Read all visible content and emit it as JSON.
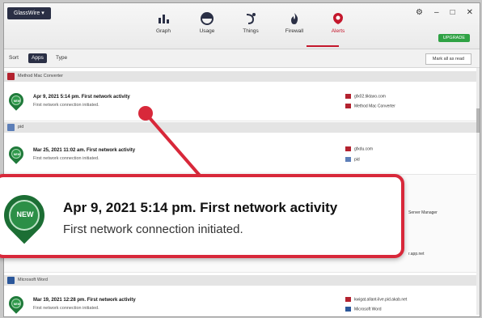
{
  "app": {
    "menu_label": "GlassWire ▾",
    "update_label": "UPGRADE"
  },
  "window_controls": [
    "⚙",
    "–",
    "□",
    "✕"
  ],
  "nav": [
    {
      "label": "Graph",
      "icon": "graph-icon"
    },
    {
      "label": "Usage",
      "icon": "usage-icon"
    },
    {
      "label": "Things",
      "icon": "things-icon"
    },
    {
      "label": "Firewall",
      "icon": "firewall-icon"
    },
    {
      "label": "Alerts",
      "icon": "alerts-icon",
      "active": true
    }
  ],
  "toolbar": {
    "sort_label": "Sort",
    "sort_options": [
      "Apps",
      "Type"
    ],
    "active_option": "Apps",
    "mark_all_label": "Mark all as read"
  },
  "groups": [
    {
      "label": "Method Mac Converter",
      "icon": "app-red-icon"
    },
    {
      "label": "pid",
      "icon": "app-blue-icon"
    },
    {
      "label": "Microsoft Word",
      "icon": "word-icon"
    }
  ],
  "alerts": [
    {
      "badge": "NEW",
      "title": "Apr 9, 2021 5:14 pm. First network activity",
      "subtitle": "First network connection initiated.",
      "right_lines": [
        "gfx02.tiktaxo.com",
        "Method Mac Converter"
      ]
    },
    {
      "badge": "NEW",
      "title": "Mar 25, 2021 11:02 am. First network activity",
      "subtitle": "First network connection initiated.",
      "right_lines": [
        "gfxdu.com",
        "pid"
      ]
    },
    {
      "badge": "NEW",
      "title": "Mar 19, 2021 12:28 pm. First network activity",
      "subtitle": "First network connection initiated.",
      "right_lines": [
        "kwigat.allant-live.pid.akab.net",
        "Microsoft Word"
      ]
    }
  ],
  "partial_right": [
    "Server Manager",
    "r.app.net"
  ],
  "callout": {
    "badge": "NEW",
    "title": "Apr 9, 2021 5:14 pm. First network activity",
    "subtitle": "First network connection initiated."
  },
  "colors": {
    "accent": "#c4172c",
    "callout_border": "#d8283a",
    "badge_green": "#2c8f47",
    "header_dark": "#2a2f45",
    "update_green": "#2fa244"
  }
}
